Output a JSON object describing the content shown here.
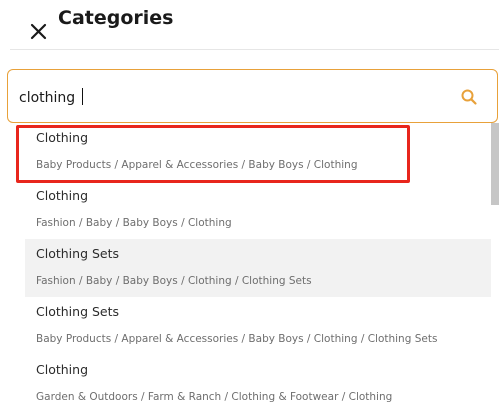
{
  "header": {
    "close_icon": "close-icon",
    "title": "Categories"
  },
  "search": {
    "value": "clothing",
    "icon": "search-icon",
    "accent_color": "#e8a13a"
  },
  "results": [
    {
      "name": "Clothing",
      "path": "Baby Products / Apparel & Accessories / Baby Boys / Clothing",
      "highlighted": true
    },
    {
      "name": "Clothing",
      "path": "Fashion / Baby / Baby Boys / Clothing",
      "highlighted": false
    },
    {
      "name": "Clothing Sets",
      "path": "Fashion / Baby / Baby Boys / Clothing / Clothing Sets",
      "highlighted": false
    },
    {
      "name": "Clothing Sets",
      "path": "Baby Products / Apparel & Accessories / Baby Boys / Clothing / Clothing Sets",
      "highlighted": false
    },
    {
      "name": "Clothing",
      "path": "Garden & Outdoors / Farm & Ranch / Clothing & Footwear / Clothing",
      "highlighted": false
    }
  ],
  "colors": {
    "highlight_border": "#e8261c",
    "hover_row": "#f2f2f2"
  }
}
